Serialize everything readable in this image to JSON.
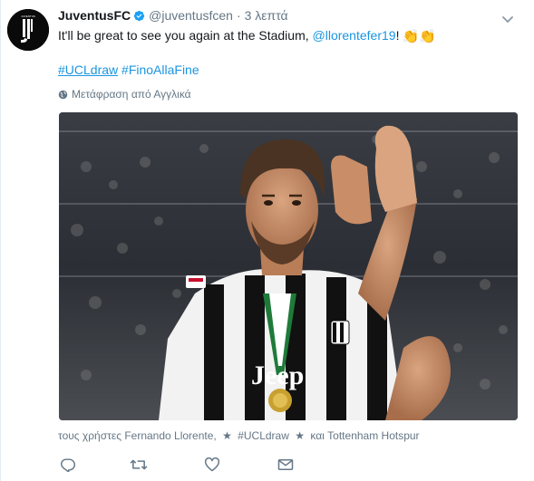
{
  "tweet": {
    "author": {
      "name": "JuventusFC",
      "handle": "@juventusfcen",
      "separator": "·",
      "time": "3 λεπτά"
    },
    "text": {
      "before_mention": "It'll be great to see you again at the Stadium, ",
      "mention": "@llorentefer19",
      "after_mention": "!",
      "emoji": "👏👏"
    },
    "hashtags": [
      "#UCLdraw",
      "#FinoAllaFine"
    ],
    "translate_label": "Μετάφραση από Αγγλικά",
    "media": {
      "alt": "Fernando Llorente applauding in Juventus jersey",
      "jersey_text": "Jeep"
    },
    "tagged": {
      "prefix": "τους χρήστες Fernando Llorente,",
      "star": "★",
      "hashtag": "#UCLdraw",
      "and": "και",
      "last": "Tottenham Hotspur"
    }
  },
  "icons": {
    "avatar": "juventus-logo-icon",
    "verified": "verified-badge-icon",
    "caret": "chevron-down-icon",
    "globe": "globe-icon",
    "reply": "reply-icon",
    "retweet": "retweet-icon",
    "like": "heart-icon",
    "dm": "envelope-icon"
  },
  "colors": {
    "link": "#1b95e0",
    "muted": "#657786",
    "text": "#14171a",
    "verified": "#1da1f2"
  }
}
